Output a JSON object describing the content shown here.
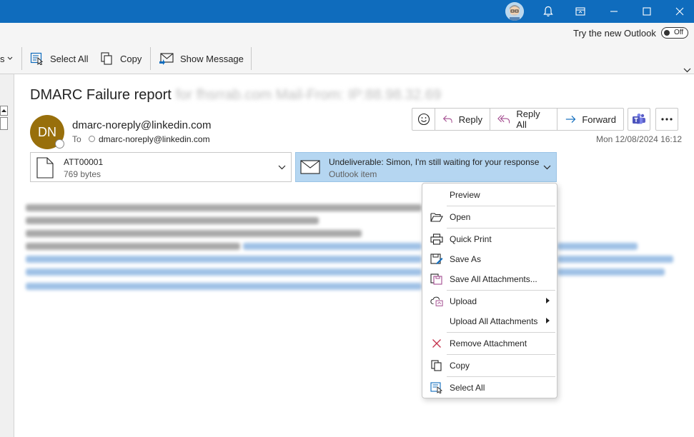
{
  "titlebar": {
    "icons": [
      "avatar-icon",
      "bell-icon",
      "restore-window-icon",
      "minimize-icon",
      "maximize-icon",
      "close-icon"
    ]
  },
  "new_outlook": {
    "label": "Try the new Outlook",
    "toggle_text": "Off"
  },
  "ribbon": {
    "partial_label": "s",
    "select_all": "Select All",
    "copy": "Copy",
    "show_message": "Show Message"
  },
  "message": {
    "subject": "DMARC Failure report",
    "subject_blurred": "for fhsrrab.com Mail-From: IP:88.98.32.69",
    "avatar_initials": "DN",
    "from": "dmarc-noreply@linkedin.com",
    "to_label": "To",
    "to": "dmarc-noreply@linkedin.com",
    "timestamp": "Mon 12/08/2024 16:12",
    "actions": {
      "reply": "Reply",
      "reply_all": "Reply All",
      "forward": "Forward"
    }
  },
  "attachments": [
    {
      "name": "ATT00001",
      "detail": "769 bytes"
    },
    {
      "name": "Undeliverable: Simon, I'm still waiting for your response",
      "detail": "Outlook item"
    }
  ],
  "context_menu": {
    "items": [
      {
        "label": "Preview",
        "icon": "none"
      },
      {
        "label": "Open",
        "icon": "folder-open-icon"
      },
      {
        "label": "Quick Print",
        "icon": "printer-icon"
      },
      {
        "label": "Save As",
        "icon": "save-as-icon"
      },
      {
        "label": "Save All Attachments...",
        "icon": "save-all-icon"
      },
      {
        "label": "Upload",
        "icon": "upload-icon",
        "submenu": true
      },
      {
        "label": "Upload All Attachments",
        "icon": "none",
        "submenu": true
      },
      {
        "label": "Remove Attachment",
        "icon": "remove-icon"
      },
      {
        "label": "Copy",
        "icon": "copy-icon"
      },
      {
        "label": "Select All",
        "icon": "select-all-icon"
      }
    ]
  },
  "colors": {
    "titlebar": "#0f6cbd",
    "accent": "#0f6cbd",
    "avatar_bg": "#986f0b",
    "selected_attachment": "#b5d6f1",
    "remove_icon": "#c4314b"
  }
}
